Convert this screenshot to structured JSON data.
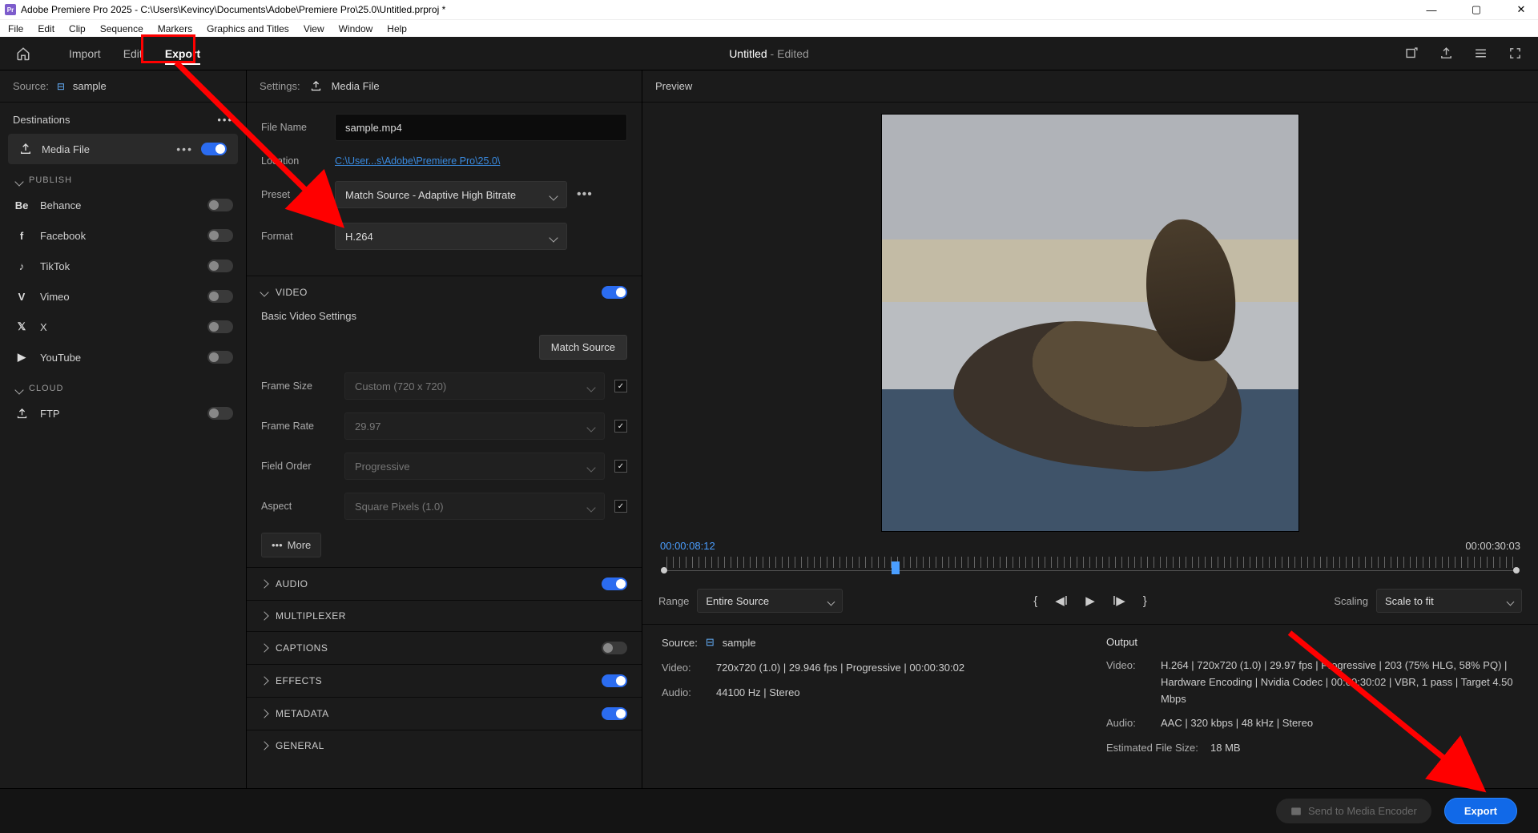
{
  "window": {
    "title": "Adobe Premiere Pro 2025 - C:\\Users\\Kevincy\\Documents\\Adobe\\Premiere Pro\\25.0\\Untitled.prproj *"
  },
  "menu": [
    "File",
    "Edit",
    "Clip",
    "Sequence",
    "Markers",
    "Graphics and Titles",
    "View",
    "Window",
    "Help"
  ],
  "topnav": {
    "tabs": [
      "Import",
      "Edit",
      "Export"
    ],
    "active": 2,
    "title": "Untitled",
    "subtitle": "Edited"
  },
  "source": {
    "label": "Source:",
    "name": "sample"
  },
  "destinations": {
    "title": "Destinations",
    "media_file": "Media File",
    "publish": "PUBLISH",
    "items": [
      {
        "icon": "Be",
        "label": "Behance"
      },
      {
        "icon": "f",
        "label": "Facebook"
      },
      {
        "icon": "♪",
        "label": "TikTok"
      },
      {
        "icon": "V",
        "label": "Vimeo"
      },
      {
        "icon": "𝕏",
        "label": "X"
      },
      {
        "icon": "▶",
        "label": "YouTube"
      }
    ],
    "cloud": "CLOUD",
    "ftp": "FTP"
  },
  "settings": {
    "label": "Settings:",
    "type": "Media File",
    "filename_lbl": "File Name",
    "filename": "sample.mp4",
    "location_lbl": "Location",
    "location": "C:\\User...s\\Adobe\\Premiere Pro\\25.0\\",
    "preset_lbl": "Preset",
    "preset": "Match Source - Adaptive High Bitrate",
    "format_lbl": "Format",
    "format": "H.264"
  },
  "video": {
    "heading": "VIDEO",
    "subhead": "Basic Video Settings",
    "match_btn": "Match Source",
    "rows": [
      {
        "lbl": "Frame Size",
        "val": "Custom (720 x 720)"
      },
      {
        "lbl": "Frame Rate",
        "val": "29.97"
      },
      {
        "lbl": "Field Order",
        "val": "Progressive"
      },
      {
        "lbl": "Aspect",
        "val": "Square Pixels (1.0)"
      }
    ],
    "more": "More"
  },
  "accordions": [
    {
      "label": "AUDIO",
      "toggle": "on"
    },
    {
      "label": "MULTIPLEXER",
      "toggle": null
    },
    {
      "label": "CAPTIONS",
      "toggle": "off"
    },
    {
      "label": "EFFECTS",
      "toggle": "on"
    },
    {
      "label": "METADATA",
      "toggle": "on"
    },
    {
      "label": "GENERAL",
      "toggle": null
    }
  ],
  "preview": {
    "label": "Preview",
    "current": "00:00:08:12",
    "duration": "00:00:30:03",
    "range_lbl": "Range",
    "range_val": "Entire Source",
    "scaling_lbl": "Scaling",
    "scaling_val": "Scale to fit"
  },
  "info_source": {
    "title": "Source:",
    "name": "sample",
    "video_lbl": "Video:",
    "video": "720x720 (1.0) | 29.946 fps | Progressive | 00:00:30:02",
    "audio_lbl": "Audio:",
    "audio": "44100 Hz | Stereo"
  },
  "info_output": {
    "title": "Output",
    "video_lbl": "Video:",
    "video": "H.264 | 720x720 (1.0) | 29.97 fps | Progressive | 203 (75% HLG, 58% PQ) | Hardware Encoding | Nvidia Codec | 00:00:30:02 | VBR, 1 pass | Target 4.50 Mbps",
    "audio_lbl": "Audio:",
    "audio": "AAC | 320 kbps | 48 kHz | Stereo",
    "size_lbl": "Estimated File Size:",
    "size": "18 MB"
  },
  "footer": {
    "send": "Send to Media Encoder",
    "export": "Export"
  }
}
